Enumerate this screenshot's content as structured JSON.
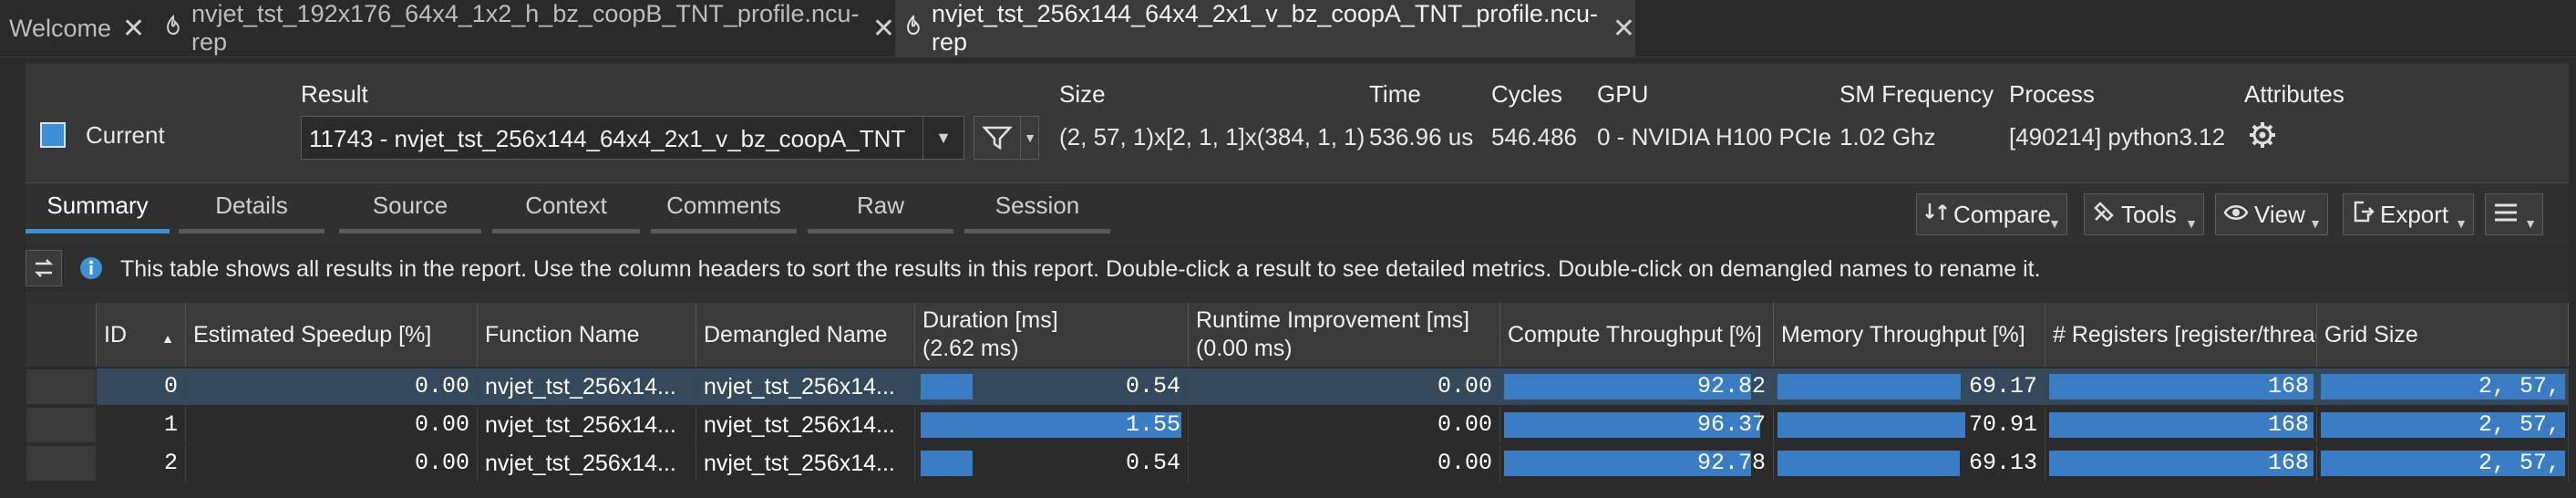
{
  "tabs": [
    {
      "label": "Welcome"
    },
    {
      "label": "nvjet_tst_192x176_64x4_1x2_h_bz_coopB_TNT_profile.ncu-rep"
    },
    {
      "label": "nvjet_tst_256x144_64x4_2x1_v_bz_coopA_TNT_profile.ncu-rep"
    }
  ],
  "header": {
    "current_label": "Current",
    "result_label": "Result",
    "result_value": "11743 - nvjet_tst_256x144_64x4_2x1_v_bz_coopA_TNT",
    "size_label": "Size",
    "size_value": "(2, 57, 1)x[2, 1, 1]x(384, 1, 1)",
    "time_label": "Time",
    "time_value": "536.96 us",
    "cycles_label": "Cycles",
    "cycles_value": "546.486",
    "gpu_label": "GPU",
    "gpu_value": "0 - NVIDIA H100 PCIe",
    "smfreq_label": "SM Frequency",
    "smfreq_value": "1.02 Ghz",
    "process_label": "Process",
    "process_value": "[490214] python3.12",
    "attributes_label": "Attributes"
  },
  "view_tabs": [
    "Summary",
    "Details",
    "Source",
    "Context",
    "Comments",
    "Raw",
    "Session"
  ],
  "toolbar": {
    "compare": "Compare",
    "tools": "Tools",
    "view": "View",
    "export": "Export"
  },
  "info_text": "This table shows all results in the report. Use the column headers to sort the results in this report. Double-click a result to see detailed metrics. Double-click on demangled names to rename it.",
  "table": {
    "columns": [
      {
        "label": "ID"
      },
      {
        "label": "Estimated Speedup [%]"
      },
      {
        "label": "Function Name"
      },
      {
        "label": "Demangled Name"
      },
      {
        "label": "Duration [ms]",
        "sub": "(2.62 ms)"
      },
      {
        "label": "Runtime Improvement [ms]",
        "sub": "(0.00 ms)"
      },
      {
        "label": "Compute Throughput [%]"
      },
      {
        "label": "Memory Throughput [%]"
      },
      {
        "label": "# Registers [register/thread]"
      },
      {
        "label": "Grid Size"
      }
    ],
    "rows": [
      {
        "id": "0",
        "speedup": "0.00",
        "func": "nvjet_tst_256x14...",
        "demangled": "nvjet_tst_256x14...",
        "duration": "0.54",
        "duration_frac": 0.345,
        "runtime": "0.00",
        "compute": "92.82",
        "compute_frac": 0.9282,
        "memory": "69.17",
        "memory_frac": 0.6917,
        "regs": "168",
        "grid": "2,   57,"
      },
      {
        "id": "1",
        "speedup": "0.00",
        "func": "nvjet_tst_256x14...",
        "demangled": "nvjet_tst_256x14...",
        "duration": "1.55",
        "duration_frac": 1.0,
        "runtime": "0.00",
        "compute": "96.37",
        "compute_frac": 0.9637,
        "memory": "70.91",
        "memory_frac": 0.7091,
        "regs": "168",
        "grid": "2,   57,"
      },
      {
        "id": "2",
        "speedup": "0.00",
        "func": "nvjet_tst_256x14...",
        "demangled": "nvjet_tst_256x14...",
        "duration": "0.54",
        "duration_frac": 0.345,
        "runtime": "0.00",
        "compute": "92.78",
        "compute_frac": 0.9278,
        "memory": "69.13",
        "memory_frac": 0.6913,
        "regs": "168",
        "grid": "2,   57,"
      }
    ]
  },
  "colors": {
    "accent": "#3d8fd6",
    "bar": "#3b7dc4",
    "selected_row": "#34495c"
  }
}
